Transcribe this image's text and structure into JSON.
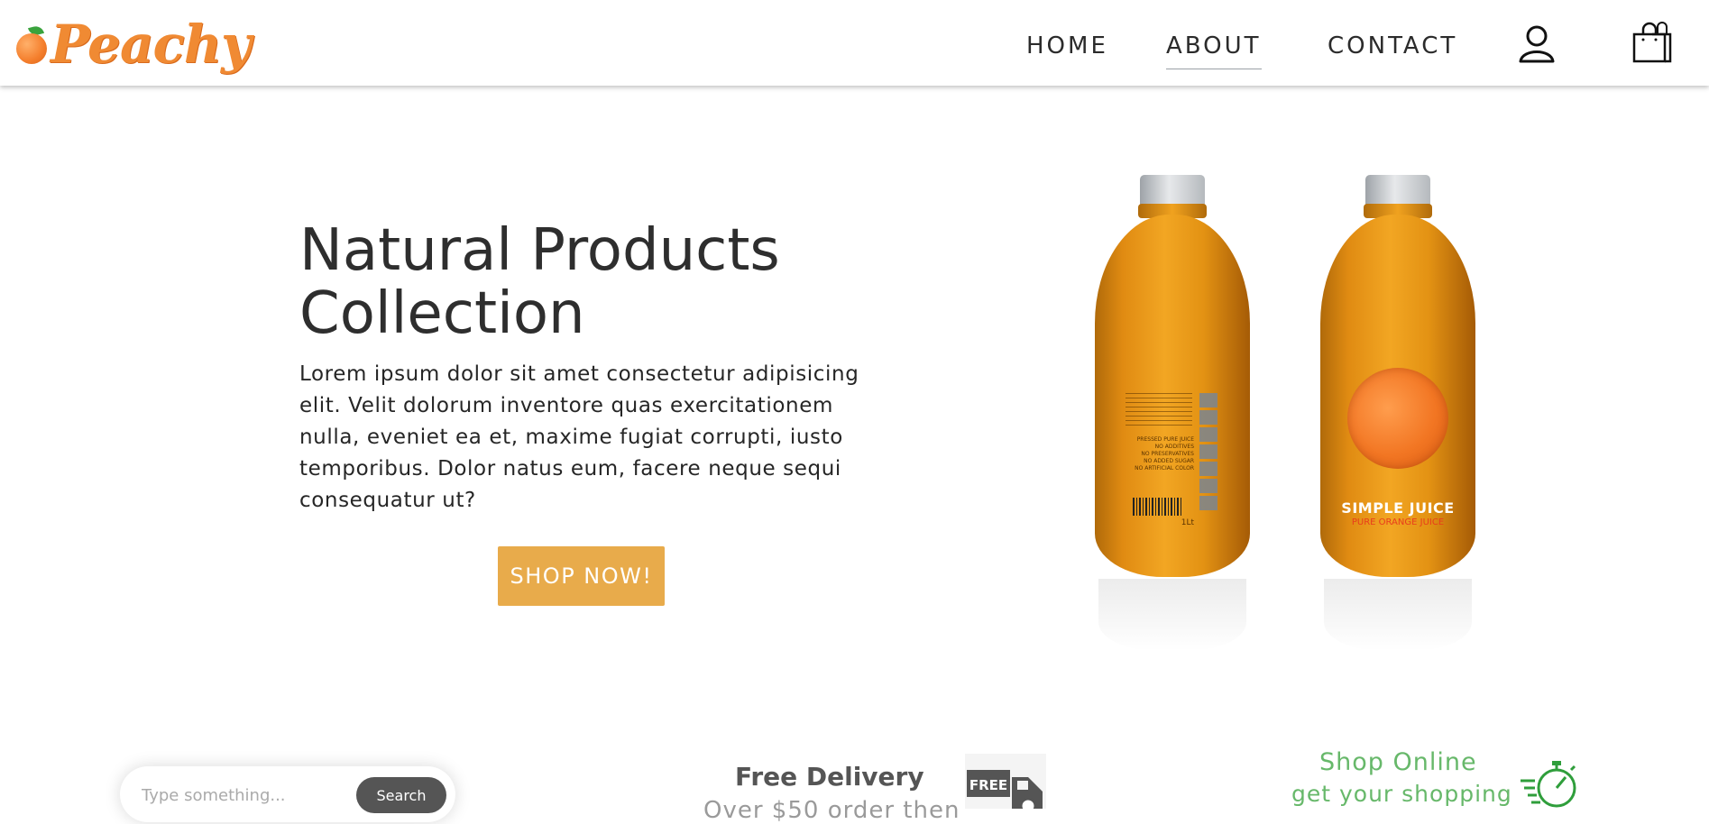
{
  "brand": {
    "name": "Peachy",
    "color": "#f08a33"
  },
  "nav": {
    "links": [
      "HOME",
      "ABOUT",
      "CONTACT"
    ],
    "active": "ABOUT",
    "icons": [
      "user-icon",
      "shopping-bag-icon"
    ]
  },
  "hero": {
    "title_line1": "Natural Products",
    "title_line2": "Collection",
    "description": "Lorem ipsum dolor sit amet consectetur adipisicing elit. Velit dolorum inventore quas exercitationem nulla, eveniet ea et, maxime fugiat corrupti, iusto temporibus. Dolor natus eum, facere neque sequi consequatur ut?",
    "cta_label": "SHOP NOW!",
    "cta_color": "#e8ab4b"
  },
  "product_image": {
    "bottle_brand": "SIMPLE JUICE",
    "bottle_sub": "PURE ORANGE JUICE",
    "back_label_lines": [
      "PRESSED PURE JUICE",
      "NO ADDITIVES",
      "NO PRESERVATIVES",
      "NO ADDED SUGAR",
      "NO ARTIFICIAL COLOR"
    ],
    "volume": "1Lt"
  },
  "search": {
    "placeholder": "Type something...",
    "button_label": "Search"
  },
  "features": {
    "delivery_title": "Free Delivery",
    "delivery_subtitle": "Over $50 order then",
    "truck_badge": "FREE",
    "online_line1": "Shop Online",
    "online_line2": "get your shopping",
    "accent_green": "#67b86a"
  }
}
